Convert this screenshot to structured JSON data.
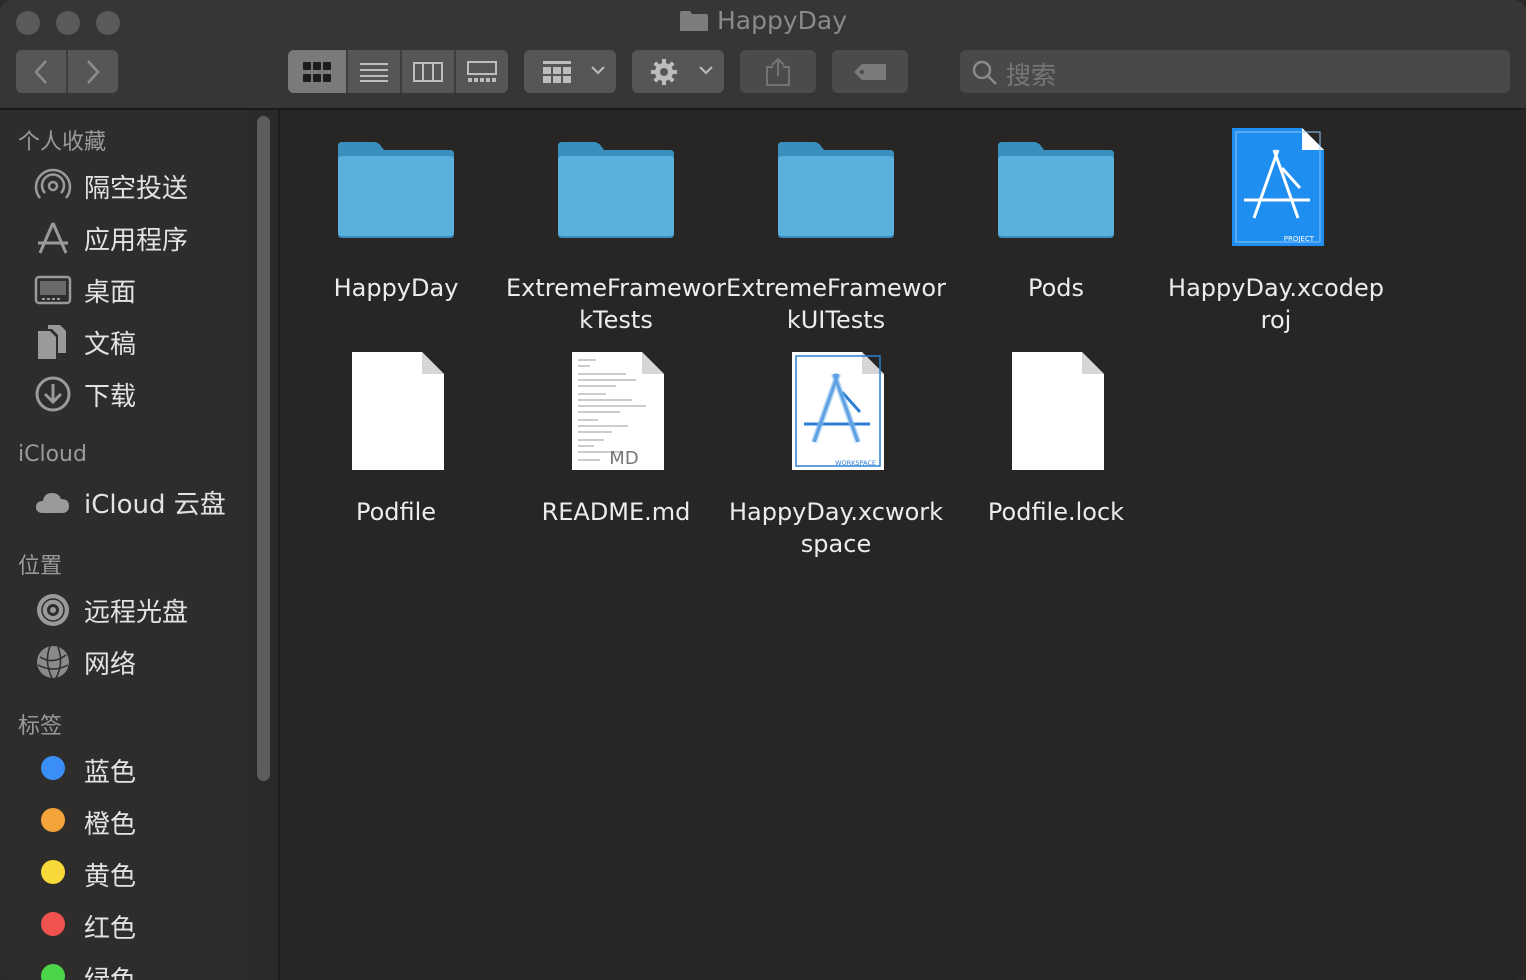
{
  "window": {
    "title": "HappyDay"
  },
  "toolbar": {
    "search_placeholder": "搜索"
  },
  "sidebar": {
    "sections": [
      {
        "title": "个人收藏",
        "items": [
          {
            "label": "隔空投送",
            "icon": "airdrop-icon"
          },
          {
            "label": "应用程序",
            "icon": "applications-icon"
          },
          {
            "label": "桌面",
            "icon": "desktop-icon"
          },
          {
            "label": "文稿",
            "icon": "documents-icon"
          },
          {
            "label": "下载",
            "icon": "downloads-icon"
          }
        ]
      },
      {
        "title": "iCloud",
        "items": [
          {
            "label": "iCloud 云盘",
            "icon": "icloud-icon"
          }
        ]
      },
      {
        "title": "位置",
        "items": [
          {
            "label": "远程光盘",
            "icon": "remote-disc-icon"
          },
          {
            "label": "网络",
            "icon": "network-icon"
          }
        ]
      },
      {
        "title": "标签",
        "items": [
          {
            "label": "蓝色",
            "color": "#3a8ef6"
          },
          {
            "label": "橙色",
            "color": "#f5a33b"
          },
          {
            "label": "黄色",
            "color": "#f7d93a"
          },
          {
            "label": "红色",
            "color": "#f0524f"
          },
          {
            "label": "绿色",
            "color": "#4cd548"
          }
        ]
      }
    ]
  },
  "files": [
    {
      "line1": "HappyDay",
      "line2": "",
      "kind": "folder"
    },
    {
      "line1": "ExtremeFramewor",
      "line2": "kTests",
      "kind": "folder"
    },
    {
      "line1": "ExtremeFramewor",
      "line2": "kUITests",
      "kind": "folder"
    },
    {
      "line1": "Pods",
      "line2": "",
      "kind": "folder"
    },
    {
      "line1": "HappyDay.xcodep",
      "line2": "roj",
      "kind": "xcodeproj",
      "badge": "PROJECT"
    },
    {
      "line1": "Podfile",
      "line2": "",
      "kind": "document"
    },
    {
      "line1": "README.md",
      "line2": "",
      "kind": "markdown",
      "badge": "MD"
    },
    {
      "line1": "HappyDay.xcwork",
      "line2": "space",
      "kind": "xcworkspace",
      "badge": "WORKSPACE"
    },
    {
      "line1": "Podfile.lock",
      "line2": "",
      "kind": "document"
    }
  ]
}
